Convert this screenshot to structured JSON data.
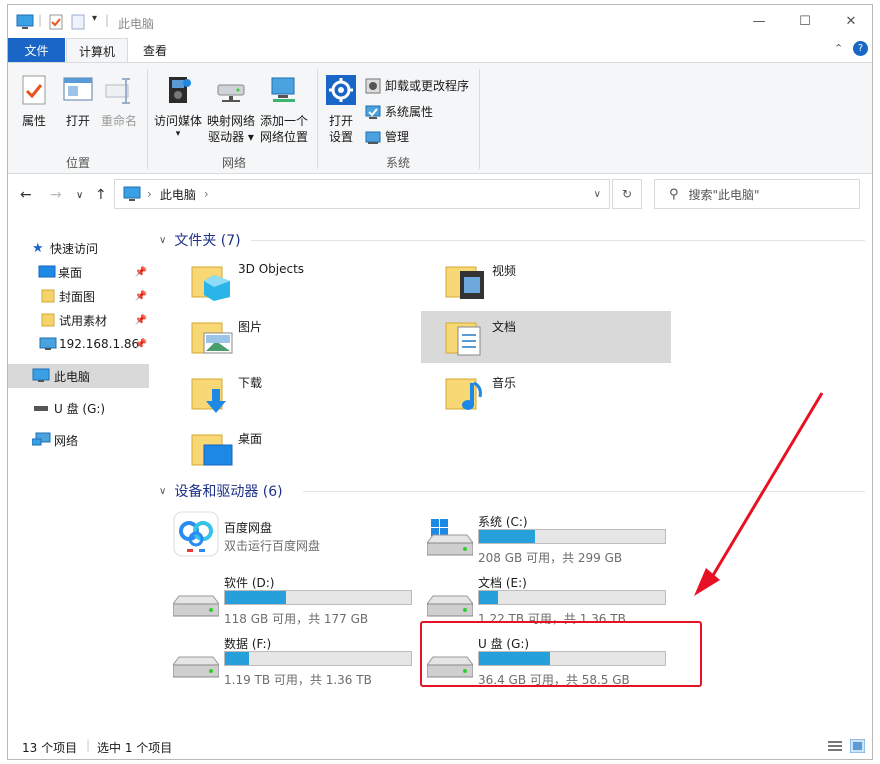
{
  "window": {
    "title": "此电脑",
    "controls": {
      "minimize": "—",
      "maximize": "☐",
      "close": "✕"
    }
  },
  "ribbon": {
    "tabs": [
      {
        "label": "文件",
        "active": false
      },
      {
        "label": "计算机",
        "active": true
      },
      {
        "label": "查看",
        "active": false
      }
    ],
    "groups": {
      "location": {
        "label": "位置",
        "buttons": [
          {
            "label": "属性",
            "icon": "properties-icon",
            "enabled": true
          },
          {
            "label": "打开",
            "icon": "open-icon",
            "enabled": true
          },
          {
            "label": "重命名",
            "icon": "rename-icon",
            "enabled": false
          }
        ]
      },
      "network": {
        "label": "网络",
        "buttons": [
          {
            "line1": "访问媒体",
            "line2": "▾",
            "icon": "media-icon"
          },
          {
            "line1": "映射网络",
            "line2": "驱动器 ▾",
            "icon": "map-drive-icon"
          },
          {
            "line1": "添加一个",
            "line2": "网络位置",
            "icon": "network-location-icon"
          }
        ]
      },
      "system": {
        "label": "系统",
        "open_settings": {
          "line1": "打开",
          "line2": "设置",
          "icon": "settings-gear-icon"
        },
        "items": [
          {
            "label": "卸载或更改程序",
            "icon": "uninstall-icon"
          },
          {
            "label": "系统属性",
            "icon": "system-properties-icon"
          },
          {
            "label": "管理",
            "icon": "manage-icon"
          }
        ]
      }
    }
  },
  "address": {
    "breadcrumb": "此电脑",
    "separator": "›",
    "search_placeholder": "搜索\"此电脑\""
  },
  "sidebar": {
    "items": [
      {
        "label": "快速访问",
        "icon": "star-icon",
        "pinned": false,
        "selected": false
      },
      {
        "label": "桌面",
        "icon": "desktop-icon",
        "pinned": true,
        "selected": false
      },
      {
        "label": "封面图",
        "icon": "folder-icon",
        "pinned": true,
        "selected": false
      },
      {
        "label": "试用素材",
        "icon": "folder-icon",
        "pinned": true,
        "selected": false
      },
      {
        "label": "192.168.1.86",
        "icon": "network-pc-icon",
        "pinned": true,
        "selected": false
      },
      {
        "label": "此电脑",
        "icon": "computer-icon",
        "pinned": false,
        "selected": true
      },
      {
        "label": "U 盘 (G:)",
        "icon": "usb-drive-icon",
        "pinned": false,
        "selected": false
      },
      {
        "label": "网络",
        "icon": "network-icon",
        "pinned": false,
        "selected": false
      }
    ]
  },
  "folders": {
    "header": "文件夹 (7)",
    "items": [
      {
        "label": "3D Objects",
        "overlay": "3d-objects-icon",
        "selected": false
      },
      {
        "label": "视频",
        "overlay": "video-icon",
        "selected": false
      },
      {
        "label": "图片",
        "overlay": "pictures-icon",
        "selected": false
      },
      {
        "label": "文档",
        "overlay": "documents-icon",
        "selected": true
      },
      {
        "label": "下载",
        "overlay": "download-icon",
        "selected": false
      },
      {
        "label": "音乐",
        "overlay": "music-icon",
        "selected": false
      },
      {
        "label": "桌面",
        "overlay": "desktop-icon",
        "selected": false
      }
    ]
  },
  "devices": {
    "header": "设备和驱动器 (6)",
    "baidu": {
      "name": "百度网盘",
      "subtitle": "双击运行百度网盘"
    },
    "drives": [
      {
        "name": "系统 (C:)",
        "info": "208 GB 可用，共 299 GB",
        "used_fraction": 0.3,
        "windows_logo": true
      },
      {
        "name": "软件 (D:)",
        "info": "118 GB 可用，共 177 GB",
        "used_fraction": 0.33,
        "windows_logo": false
      },
      {
        "name": "文档 (E:)",
        "info": "1.22 TB 可用，共 1.36 TB",
        "used_fraction": 0.1,
        "windows_logo": false
      },
      {
        "name": "数据 (F:)",
        "info": "1.19 TB 可用，共 1.36 TB",
        "used_fraction": 0.13,
        "windows_logo": false
      },
      {
        "name": "U 盘 (G:)",
        "info": "36.4 GB 可用，共 58.5 GB",
        "used_fraction": 0.38,
        "windows_logo": false
      }
    ]
  },
  "status": {
    "count": "13 个项目",
    "selected": "选中 1 个项目"
  },
  "colors": {
    "accent": "#1a66c6",
    "bar_fill": "#26a0da",
    "highlight": "#e81123",
    "selection": "#d9d9d9"
  }
}
